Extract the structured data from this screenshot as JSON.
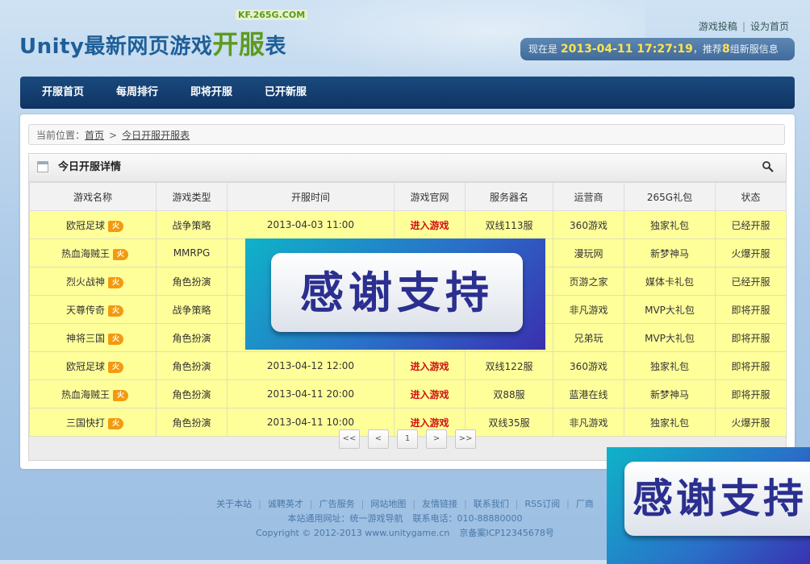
{
  "header": {
    "logo_main": "Unity最新网页游戏",
    "logo_kf": "开服",
    "logo_tail": "表",
    "logo_sub": "KF.265G.COM",
    "top_links": [
      "游戏投稿",
      "设为首页"
    ],
    "time_prefix": "现在是",
    "time_value": "2013-04-11 17:27:19",
    "time_mid": "，推荐",
    "time_count": "8",
    "time_suffix": "组新服信息"
  },
  "nav": {
    "items": [
      "开服首页",
      "每周排行",
      "即将开服",
      "已开新服"
    ]
  },
  "breadcrumb": {
    "label": "当前位置：",
    "home": "首页",
    "sep": ">",
    "current": "今日开服开服表"
  },
  "box": {
    "title": "今日开服详情",
    "search_icon": "search-icon"
  },
  "table": {
    "headers": [
      "游戏名称",
      "游戏类型",
      "开服时间",
      "游戏官网",
      "服务器名",
      "运营商",
      "265G礼包",
      "状态"
    ],
    "hot_label": "火",
    "rows": [
      {
        "name": "欧冠足球",
        "type": "战争策略",
        "time": "2013-04-03 11:00",
        "site": "进入游戏",
        "server": "双线113服",
        "op": "360游戏",
        "gift": "独家礼包",
        "status": "已经开服"
      },
      {
        "name": "热血海贼王",
        "type": "MMRPG",
        "time": "",
        "site": "",
        "server": "",
        "op": "漫玩网",
        "gift": "新梦神马",
        "status": "火爆开服"
      },
      {
        "name": "烈火战神",
        "type": "角色扮演",
        "time": "",
        "site": "",
        "server": "",
        "op": "页游之家",
        "gift": "媒体卡礼包",
        "status": "已经开服"
      },
      {
        "name": "天尊传奇",
        "type": "战争策略",
        "time": "",
        "site": "",
        "server": "",
        "op": "非凡游戏",
        "gift": "MVP大礼包",
        "status": "即将开服"
      },
      {
        "name": "神将三国",
        "type": "角色扮演",
        "time": "",
        "site": "",
        "server": "",
        "op": "兄弟玩",
        "gift": "MVP大礼包",
        "status": "即将开服"
      },
      {
        "name": "欧冠足球",
        "type": "角色扮演",
        "time": "2013-04-12 12:00",
        "site": "进入游戏",
        "server": "双线122服",
        "op": "360游戏",
        "gift": "独家礼包",
        "status": "即将开服"
      },
      {
        "name": "热血海贼王",
        "type": "角色扮演",
        "time": "2013-04-11 20:00",
        "site": "进入游戏",
        "server": "双88服",
        "op": "蓝港在线",
        "gift": "新梦神马",
        "status": "即将开服"
      },
      {
        "name": "三国快打",
        "type": "角色扮演",
        "time": "2013-04-11 10:00",
        "site": "进入游戏",
        "server": "双线35服",
        "op": "非凡游戏",
        "gift": "独家礼包",
        "status": "火爆开服"
      }
    ]
  },
  "pager": {
    "first": "<<",
    "prev": "<",
    "current": "1",
    "next": ">",
    "last": ">>"
  },
  "promo": {
    "text": "感谢支持"
  },
  "footer": {
    "links": [
      "关于本站",
      "诚聘英才",
      "广告服务",
      "网站地图",
      "友情链接",
      "联系我们",
      "RSS订阅",
      "厂商"
    ],
    "line2_a": "本站通用网址：统一游戏导航",
    "line2_b": "联系电话：010-88880000",
    "copyright": "Copyright © 2012-2013 www.unitygame.cn",
    "icp": "京备案ICP12345678号"
  }
}
